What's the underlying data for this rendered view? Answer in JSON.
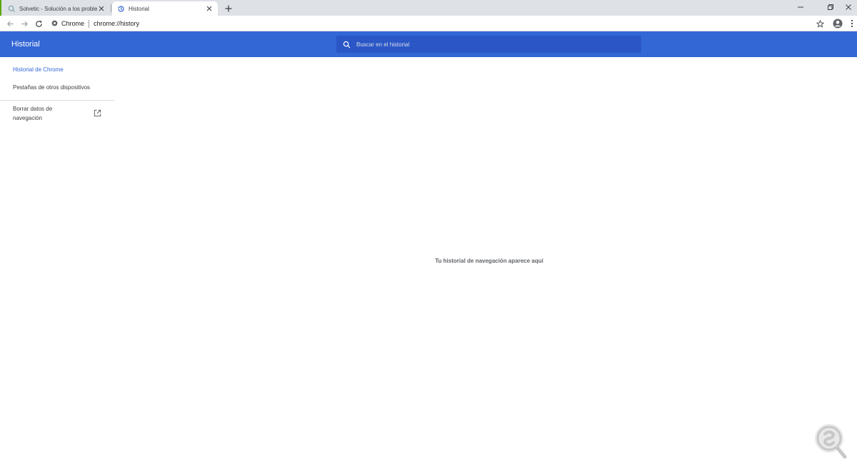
{
  "browser": {
    "tabs": [
      {
        "title": "Solvetic - Solución a los problemas",
        "active": false,
        "icon": "search-favicon-icon"
      },
      {
        "title": "Historial",
        "active": true,
        "icon": "history-icon"
      }
    ],
    "omnibox": {
      "chip": "Chrome",
      "url": "chrome://history"
    },
    "colors": {
      "tabstrip": "#dee1e6",
      "accent": "#3367d6",
      "search_bg": "#2a56c6"
    }
  },
  "history": {
    "title": "Historial",
    "search": {
      "placeholder": "Buscar en el historial"
    },
    "sidebar": {
      "items": [
        {
          "label": "Historial de Chrome",
          "selected": true
        },
        {
          "label": "Pestañas de otros dispositivos",
          "selected": false
        }
      ],
      "clear_data_label": "Borrar datos de navegación"
    },
    "empty_message": "Tu historial de navegación aparece aquí"
  }
}
